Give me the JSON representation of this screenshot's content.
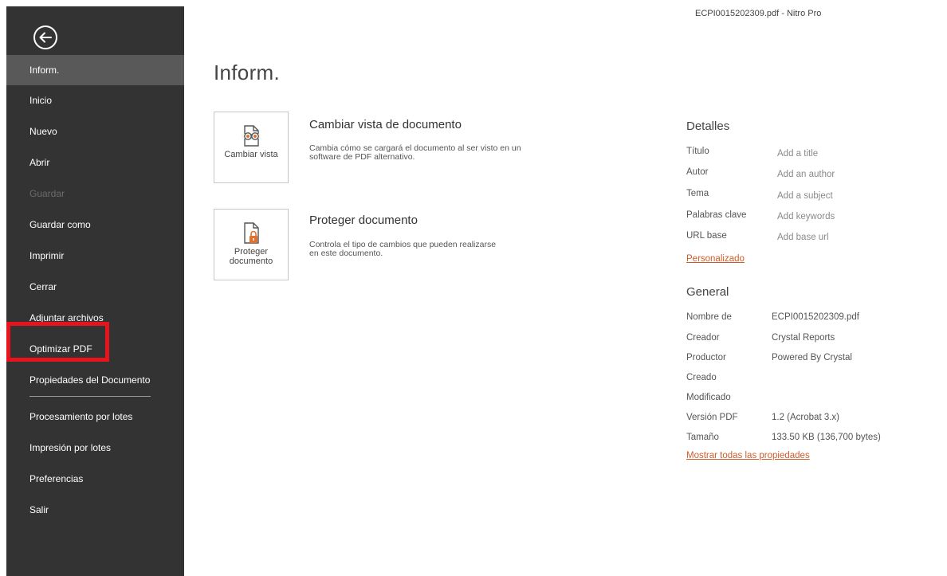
{
  "window": {
    "title": "ECPI0015202309.pdf - Nitro Pro"
  },
  "sidebar": {
    "back_icon": "back-arrow-circle-icon",
    "items": [
      {
        "label": "Inform.",
        "state": "active"
      },
      {
        "label": "Inicio",
        "state": "normal"
      },
      {
        "label": "Nuevo",
        "state": "normal"
      },
      {
        "label": "Abrir",
        "state": "normal"
      },
      {
        "label": "Guardar",
        "state": "disabled"
      },
      {
        "label": "Guardar como",
        "state": "normal"
      },
      {
        "label": "Imprimir",
        "state": "normal"
      },
      {
        "label": "Cerrar",
        "state": "normal"
      },
      {
        "label": "Adjuntar archivos",
        "state": "normal"
      },
      {
        "label": "Optimizar PDF",
        "state": "highlighted"
      },
      {
        "label": "Propiedades del Documento",
        "state": "normal"
      },
      {
        "label": "Procesamiento por lotes",
        "state": "normal"
      },
      {
        "label": "Impresión por lotes",
        "state": "normal"
      },
      {
        "label": "Preferencias",
        "state": "normal"
      },
      {
        "label": "Salir",
        "state": "normal"
      }
    ]
  },
  "main": {
    "title": "Inform.",
    "actions": [
      {
        "button_label": "Cambiar vista",
        "icon": "binoculars-document-icon",
        "title": "Cambiar vista de documento",
        "description": "Cambia cómo se cargará el documento al ser visto en un software de PDF alternativo."
      },
      {
        "button_label": "Proteger documento",
        "icon": "lock-document-icon",
        "title": "Proteger documento",
        "description": "Controla el tipo de cambios que pueden realizarse en este documento."
      }
    ]
  },
  "details": {
    "heading": "Detalles",
    "rows": [
      {
        "label": "Título",
        "value": "Add a title"
      },
      {
        "label": "Autor",
        "value": "Add an author"
      },
      {
        "label": "Tema",
        "value": "Add a subject"
      },
      {
        "label": "Palabras clave",
        "value": "Add keywords"
      },
      {
        "label": "URL base",
        "value": "Add base url"
      }
    ],
    "custom_link": "Personalizado"
  },
  "general": {
    "heading": "General",
    "rows": [
      {
        "label": "Nombre de",
        "value": "ECPI0015202309.pdf"
      },
      {
        "label": "Creador",
        "value": "Crystal Reports"
      },
      {
        "label": "Productor",
        "value": "Powered By Crystal"
      },
      {
        "label": "Creado",
        "value": ""
      },
      {
        "label": "Modificado",
        "value": ""
      },
      {
        "label": "Versión PDF",
        "value": "1.2 (Acrobat 3.x)"
      },
      {
        "label": "Tamaño",
        "value": "133.50 KB (136,700 bytes)"
      }
    ],
    "show_all_link": "Mostrar todas las propiedades"
  },
  "colors": {
    "sidebar_bg": "#333333",
    "active_item_bg": "#595959",
    "link_orange": "#d05c2a",
    "highlight_red": "#e8141c"
  }
}
